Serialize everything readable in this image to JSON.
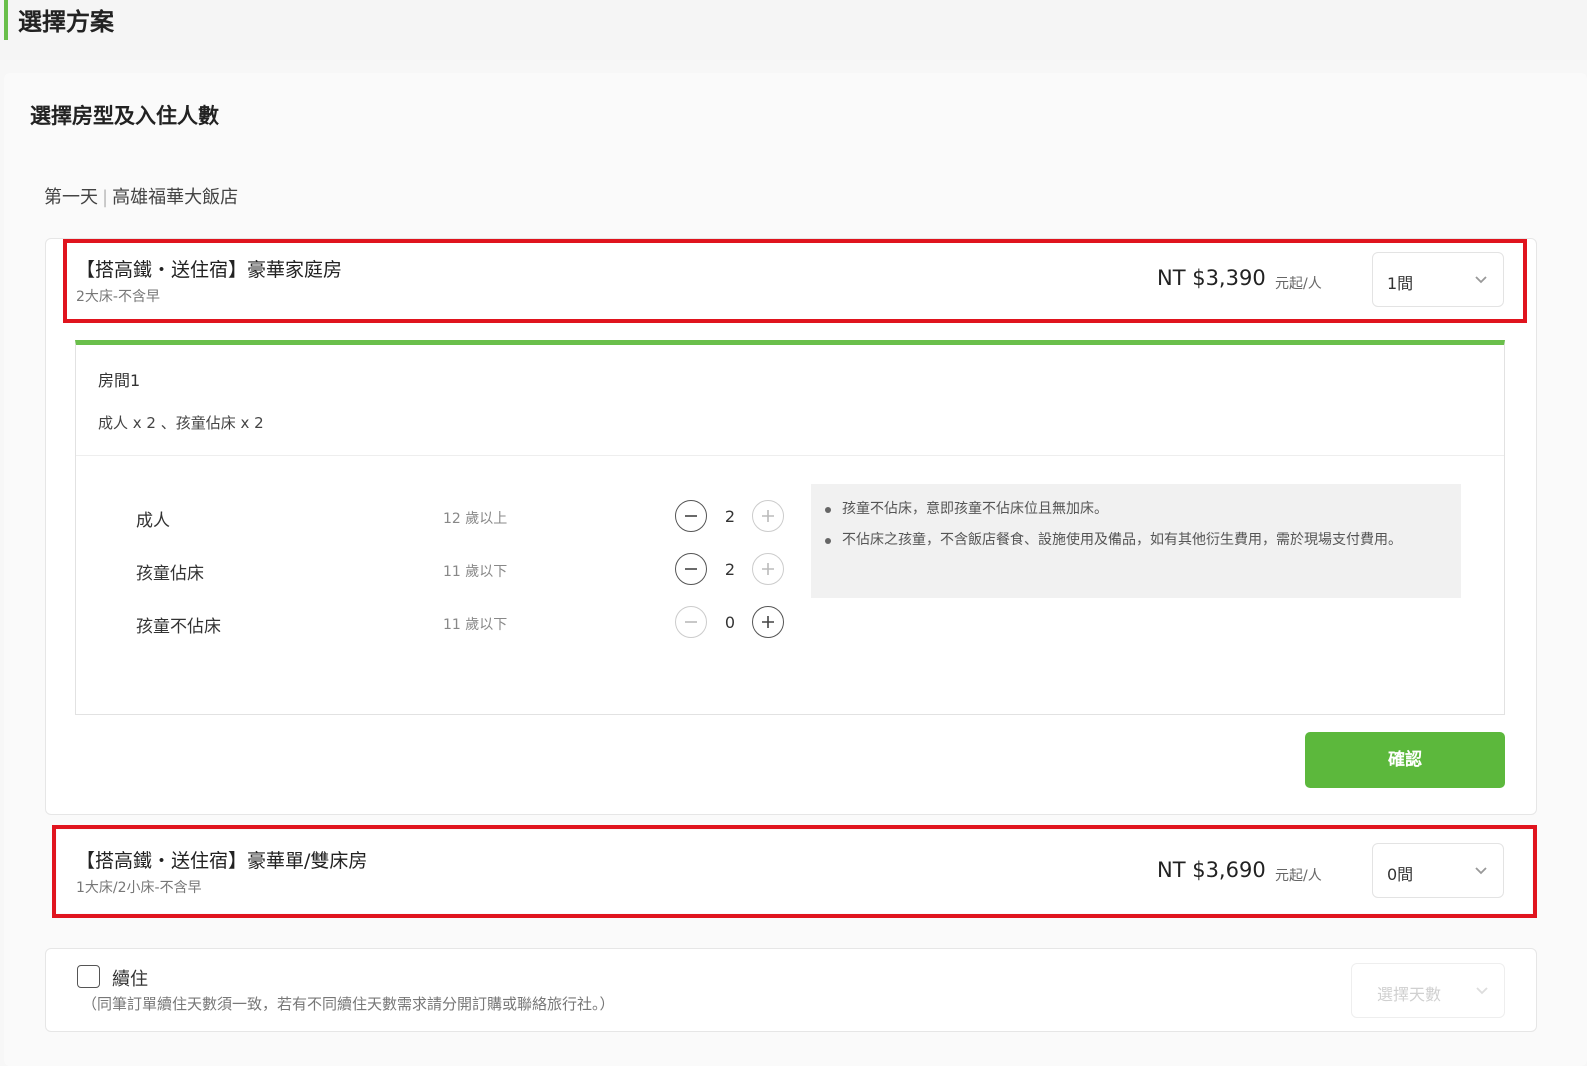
{
  "section": {
    "title": "選擇方案"
  },
  "panel": {
    "title": "選擇房型及入住人數",
    "day": "第一天",
    "hotel": "高雄福華大飯店"
  },
  "rooms": [
    {
      "name": "【搭高鐵・送住宿】豪華家庭房",
      "desc": "2大床-不含早",
      "price": "NT $3,390",
      "unit": "元起/人",
      "qty": "1間"
    },
    {
      "name": "【搭高鐵・送住宿】豪華單/雙床房",
      "desc": "1大床/2小床-不含早",
      "price": "NT $3,690",
      "unit": "元起/人",
      "qty": "0間"
    }
  ],
  "room_detail": {
    "title": "房間1",
    "summary": "成人 x 2 、孩童佔床 x 2",
    "guests": [
      {
        "label": "成人",
        "age": "12 歲以上",
        "count": "2"
      },
      {
        "label": "孩童佔床",
        "age": "11 歲以下",
        "count": "2"
      },
      {
        "label": "孩童不佔床",
        "age": "11 歲以下",
        "count": "0"
      }
    ],
    "notes": [
      "孩童不佔床，意即孩童不佔床位且無加床。",
      "不佔床之孩童，不含飯店餐食、設施使用及備品，如有其他衍生費用，需於現場支付費用。"
    ],
    "confirm_label": "確認"
  },
  "extended_stay": {
    "label": "續住",
    "note": "（同筆訂單續住天數須一致，若有不同續住天數需求請分開訂購或聯絡旅行社。）",
    "select_placeholder": "選擇天數"
  },
  "colors": {
    "accent": "#5cb83c",
    "highlight": "#e0141e"
  }
}
